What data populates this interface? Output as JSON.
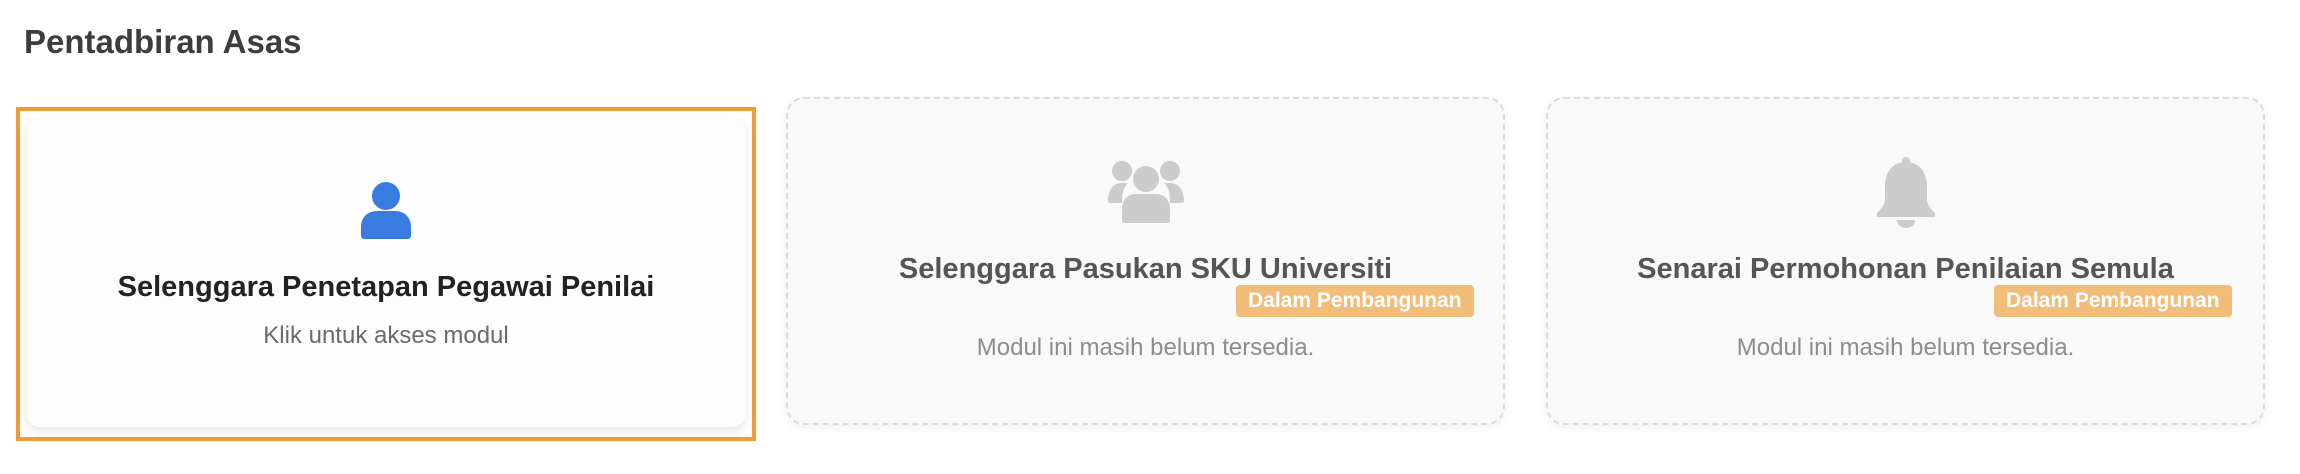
{
  "section": {
    "title": "Pentadbiran Asas"
  },
  "cards": [
    {
      "title": "Selenggara Penetapan Pegawai Penilai",
      "description": "Klik untuk akses modul",
      "icon": "user-icon",
      "icon_color": "#3a7be0",
      "state": "active",
      "highlight_color": "#f09a38"
    },
    {
      "title": "Selenggara Pasukan SKU Universiti",
      "badge": "Dalam Pembangunan",
      "description": "Modul ini masih belum tersedia.",
      "icon": "users-group-icon",
      "icon_color": "#cccccc",
      "state": "disabled"
    },
    {
      "title": "Senarai Permohonan Penilaian Semula",
      "badge": "Dalam Pembangunan",
      "description": "Modul ini masih belum tersedia.",
      "icon": "bell-icon",
      "icon_color": "#cccccc",
      "state": "disabled"
    }
  ],
  "colors": {
    "badge_bg": "#f2bd79",
    "badge_text": "#ffffff"
  }
}
